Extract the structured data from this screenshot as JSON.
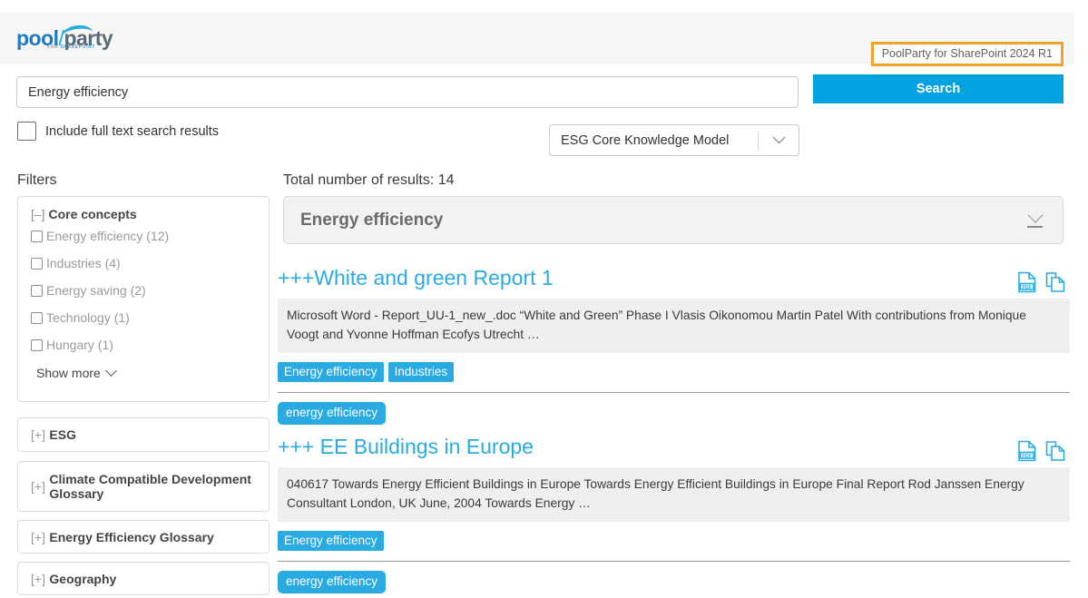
{
  "header": {
    "logo": {
      "pool": "pool",
      "party": "party",
      "sub_for": "FOR ",
      "sub_product": "SHAREPOINT"
    },
    "version_badge": "PoolParty for SharePoint 2024 R1",
    "badge_border_color": "#f0a22a"
  },
  "search": {
    "query_value": "Energy efficiency",
    "query_placeholder": "Search",
    "button_label": "Search",
    "fulltext_label": "Include full text search results",
    "fulltext_checked": false,
    "knowledge_model_selected": "ESG Core Knowledge Model",
    "chevron_icon": "chevron-down-icon"
  },
  "filters": {
    "title": "Filters",
    "core": {
      "bracket": "[–]",
      "label": "Core concepts",
      "items": [
        {
          "label": "Energy efficiency (12)",
          "checked": false
        },
        {
          "label": "Industries (4)",
          "checked": false
        },
        {
          "label": "Energy saving (2)",
          "checked": false
        },
        {
          "label": "Technology (1)",
          "checked": false
        },
        {
          "label": "Hungary (1)",
          "checked": false
        }
      ],
      "show_more": "Show more"
    },
    "collapsed": [
      {
        "bracket": "[+]",
        "label": "ESG"
      },
      {
        "bracket": "[+]",
        "label": "Climate Compatible Development Glossary"
      },
      {
        "bracket": "[+]",
        "label": "Energy Efficiency Glossary"
      },
      {
        "bracket": "[+]",
        "label": "Geography"
      }
    ]
  },
  "results": {
    "total_label": "Total number of results: 14",
    "concept_banner": {
      "title": "Energy efficiency",
      "toggle_icon": "chevron-down-collapse-icon"
    },
    "items": [
      {
        "title": "+++White and green Report 1",
        "snippet": "Microsoft Word - Report_UU-1_new_.doc            “White and Green” Phase I Vlasis Oikonomou Martin Patel With contributions from Monique Voogt and Yvonne Hoffman Ecofys Utrecht …",
        "concept_tags": [
          "Energy efficiency",
          "Industries"
        ],
        "free_tags": [
          "energy efficiency"
        ],
        "icons": [
          "pdf-file-icon",
          "copy-document-icon"
        ]
      },
      {
        "title": "+++ EE Buildings in Europe",
        "snippet": "040617 Towards Energy Efficient Buildings in Europe Towards Energy Efficient Buildings in Europe Final Report Rod Janssen Energy Consultant London, UK June, 2004 Towards Energy …",
        "concept_tags": [
          "Energy efficiency"
        ],
        "free_tags": [
          "energy efficiency"
        ],
        "icons": [
          "pdf-file-icon",
          "copy-document-icon"
        ]
      }
    ]
  },
  "colors": {
    "accent": "#29abe2",
    "button": "#00a3e0",
    "badge_orange": "#f0a22a",
    "tag": "#29abe2"
  }
}
